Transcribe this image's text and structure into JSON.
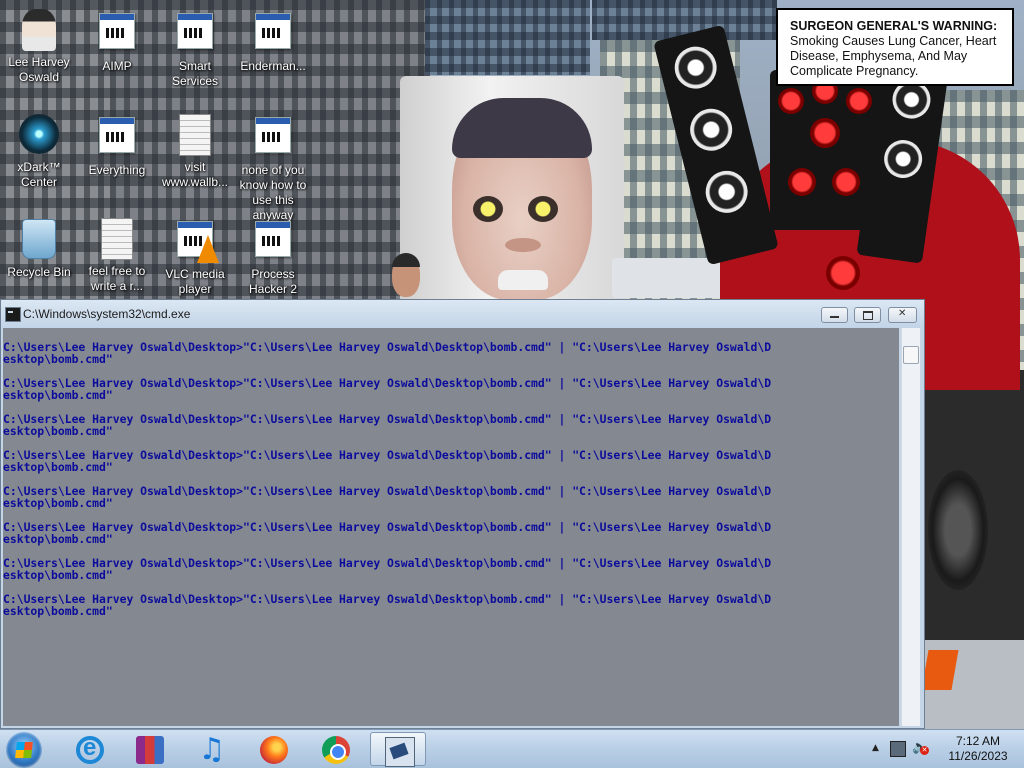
{
  "desktop": {
    "icons": [
      {
        "id": "lee-harvey-oswald",
        "label": "Lee Harvey Oswald"
      },
      {
        "id": "aimp",
        "label": "AIMP"
      },
      {
        "id": "smart-services",
        "label": "Smart Services"
      },
      {
        "id": "enderman",
        "label": "Enderman..."
      },
      {
        "id": "xdark-center",
        "label": "xDark™ Center"
      },
      {
        "id": "everything",
        "label": "Everything"
      },
      {
        "id": "visit-wallb",
        "label": "visit www.wallb..."
      },
      {
        "id": "none-of-you",
        "label": "none of you know how to use this anyway"
      },
      {
        "id": "recycle-bin",
        "label": "Recycle Bin"
      },
      {
        "id": "feel-free",
        "label": "feel free to write a r..."
      },
      {
        "id": "vlc",
        "label": "VLC media player"
      },
      {
        "id": "process-hacker",
        "label": "Process Hacker 2"
      }
    ],
    "wallpaper_warning": {
      "heading": "SURGEON GENERAL'S WARNING:",
      "text": "Smoking Causes Lung Cancer, Heart Disease, Emphysema, And May Complicate Pregnancy."
    }
  },
  "cmd_window": {
    "title": "C:\\Windows\\system32\\cmd.exe",
    "lines": [
      {
        "line1": "C:\\Users\\Lee Harvey Oswald\\Desktop>\"C:\\Users\\Lee Harvey Oswald\\Desktop\\bomb.cmd\" | \"C:\\Users\\Lee Harvey Oswald\\D",
        "line2": "esktop\\bomb.cmd\""
      },
      {
        "line1": "C:\\Users\\Lee Harvey Oswald\\Desktop>\"C:\\Users\\Lee Harvey Oswald\\Desktop\\bomb.cmd\" | \"C:\\Users\\Lee Harvey Oswald\\D",
        "line2": "esktop\\bomb.cmd\""
      },
      {
        "line1": "C:\\Users\\Lee Harvey Oswald\\Desktop>\"C:\\Users\\Lee Harvey Oswald\\Desktop\\bomb.cmd\" | \"C:\\Users\\Lee Harvey Oswald\\D",
        "line2": "esktop\\bomb.cmd\""
      },
      {
        "line1": "C:\\Users\\Lee Harvey Oswald\\Desktop>\"C:\\Users\\Lee Harvey Oswald\\Desktop\\bomb.cmd\" | \"C:\\Users\\Lee Harvey Oswald\\D",
        "line2": "esktop\\bomb.cmd\""
      },
      {
        "line1": "C:\\Users\\Lee Harvey Oswald\\Desktop>\"C:\\Users\\Lee Harvey Oswald\\Desktop\\bomb.cmd\" | \"C:\\Users\\Lee Harvey Oswald\\D",
        "line2": "esktop\\bomb.cmd\""
      },
      {
        "line1": "C:\\Users\\Lee Harvey Oswald\\Desktop>\"C:\\Users\\Lee Harvey Oswald\\Desktop\\bomb.cmd\" | \"C:\\Users\\Lee Harvey Oswald\\D",
        "line2": "esktop\\bomb.cmd\""
      },
      {
        "line1": "C:\\Users\\Lee Harvey Oswald\\Desktop>\"C:\\Users\\Lee Harvey Oswald\\Desktop\\bomb.cmd\" | \"C:\\Users\\Lee Harvey Oswald\\D",
        "line2": "esktop\\bomb.cmd\""
      },
      {
        "line1": "C:\\Users\\Lee Harvey Oswald\\Desktop>\"C:\\Users\\Lee Harvey Oswald\\Desktop\\bomb.cmd\" | \"C:\\Users\\Lee Harvey Oswald\\D",
        "line2": "esktop\\bomb.cmd\""
      }
    ],
    "colors": {
      "background": "#848890",
      "text": "#0c0c9c"
    }
  },
  "taskbar": {
    "pinned": [
      {
        "id": "internet-explorer",
        "icon": "internet-explorer-icon"
      },
      {
        "id": "winrar",
        "icon": "winrar-icon"
      },
      {
        "id": "itunes",
        "icon": "music-note-icon"
      },
      {
        "id": "firefox",
        "icon": "firefox-icon"
      },
      {
        "id": "chrome",
        "icon": "chrome-icon"
      },
      {
        "id": "cmd",
        "icon": "cmd-icon",
        "active": true
      }
    ],
    "clock": {
      "time": "7:12 AM",
      "date": "11/26/2023"
    }
  }
}
